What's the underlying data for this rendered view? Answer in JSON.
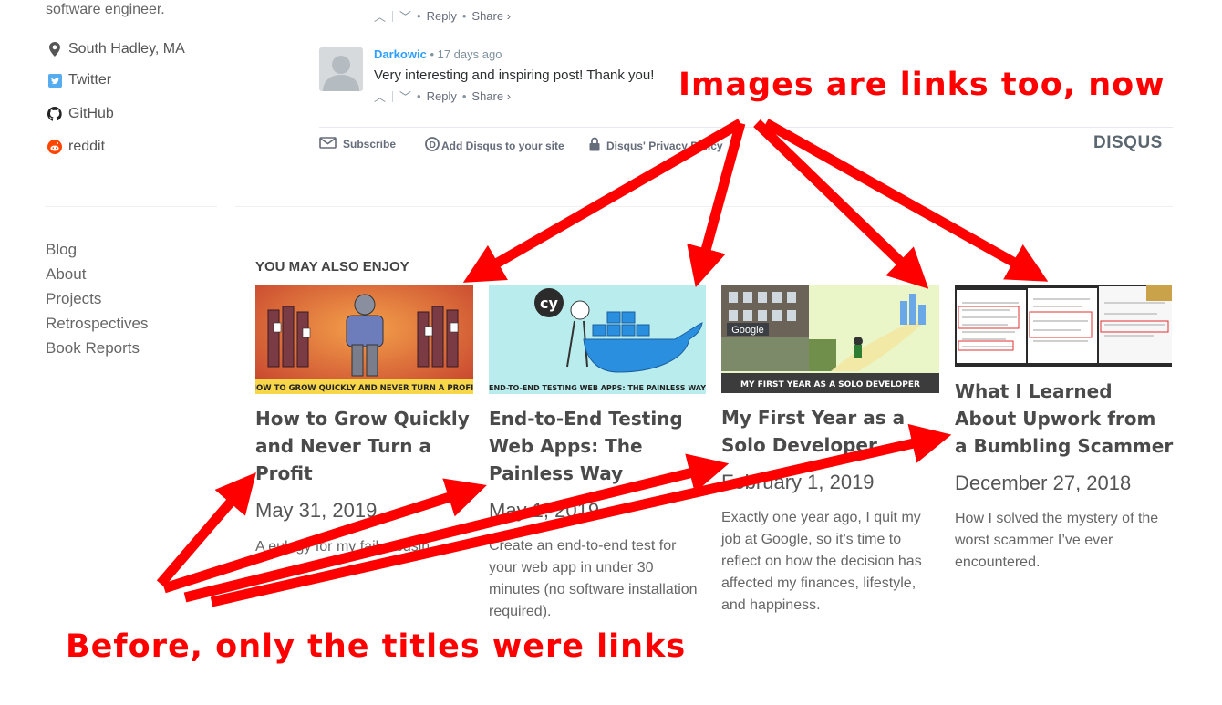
{
  "sidebar": {
    "bio_tail": "software engineer.",
    "links": [
      {
        "label": "South Hadley, MA",
        "icon": "location-pin-icon"
      },
      {
        "label": "Twitter",
        "icon": "twitter-icon"
      },
      {
        "label": "GitHub",
        "icon": "github-icon"
      },
      {
        "label": "reddit",
        "icon": "reddit-icon"
      }
    ],
    "nav": [
      "Blog",
      "About",
      "Projects",
      "Retrospectives",
      "Book Reports"
    ]
  },
  "comments": {
    "prev_reply": "Reply",
    "prev_share": "Share ›",
    "author": "Darkowic",
    "time": "17 days ago",
    "text": "Very interesting and inspiring post! Thank you!",
    "reply": "Reply",
    "share": "Share ›",
    "footer": {
      "subscribe": "Subscribe",
      "add_disqus": "Add Disqus to your site",
      "privacy": "Disqus' Privacy Policy",
      "logo": "DISQUS"
    }
  },
  "related": {
    "heading": "YOU MAY ALSO ENJOY",
    "cards": [
      {
        "title": "How to Grow Quickly and Never Turn a Profit",
        "date": "May 31, 2019",
        "desc": "A eulogy for my fail... busin...",
        "image_caption": "HOW TO GROW QUICKLY AND NEVER TURN A PROFIT"
      },
      {
        "title": "End-to-End Testing Web Apps: The Painless Way",
        "date": "May 1, 2019",
        "desc": "Create an end-to-end test for your web app in under 30 minutes (no software installation required).",
        "image_caption": "END-TO-END TESTING WEB APPS: THE PAINLESS WAY"
      },
      {
        "title": "My First Year as a Solo Developer",
        "date": "February 1, 2019",
        "desc": "Exactly one year ago, I quit my job at Google, so it’s time to reflect on how the decision has affected my finances, lifestyle, and happiness.",
        "image_caption": "MY FIRST YEAR AS A SOLO DEVELOPER"
      },
      {
        "title": "What I Learned About Upwork from a Bumbling Scammer",
        "date": "December 27, 2018",
        "desc": "How I solved the mystery of the worst scammer I’ve ever encountered.",
        "image_caption": ""
      }
    ]
  },
  "annotations": {
    "top": "Images are links too, now",
    "bottom": "Before, only the titles were links"
  },
  "colors": {
    "annotation": "#ff0000",
    "disqus_link": "#2e9fff"
  }
}
